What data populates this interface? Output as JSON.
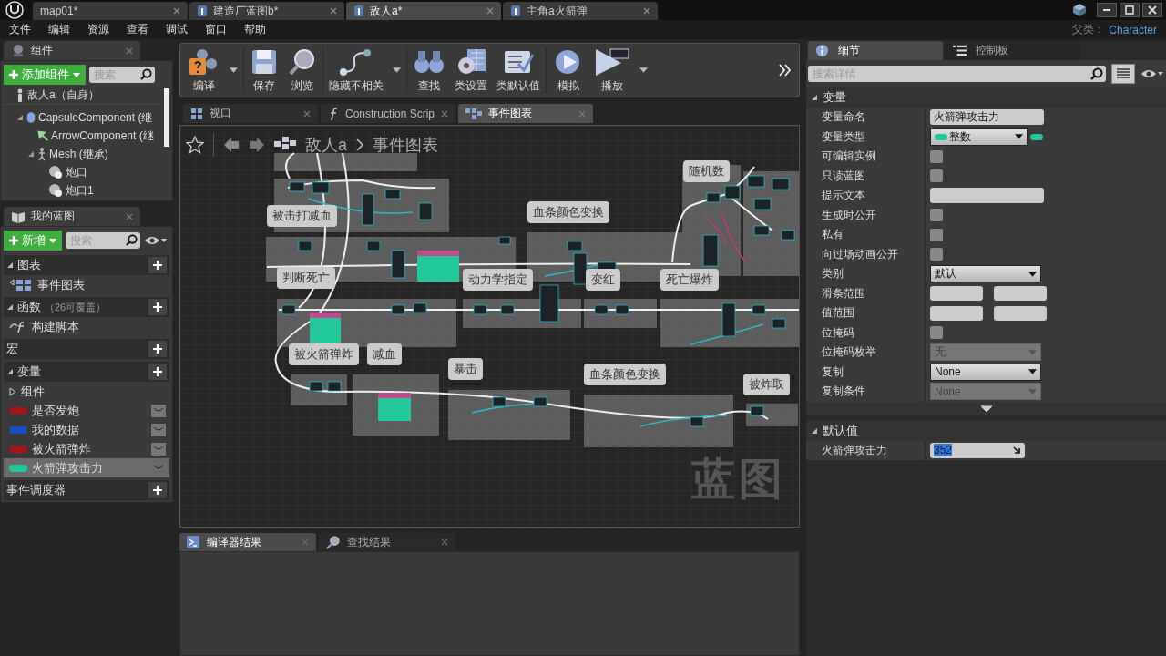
{
  "title_tabs": [
    {
      "label": "map01*",
      "kind": "level",
      "selected": false
    },
    {
      "label": "建造厂蓝图b*",
      "kind": "blueprint",
      "selected": false
    },
    {
      "label": "敌人a*",
      "kind": "blueprint",
      "selected": true
    },
    {
      "label": "主角a火箭弹",
      "kind": "blueprint",
      "selected": false
    }
  ],
  "menu": [
    "文件",
    "编辑",
    "资源",
    "查看",
    "调试",
    "窗口",
    "帮助"
  ],
  "parent_class": {
    "label": "父类：",
    "value": "Character"
  },
  "components_panel": {
    "tab": "组件",
    "add_button": "添加组件",
    "search_placeholder": "搜索",
    "tree": [
      {
        "label": "敌人a（自身）",
        "kind": "self",
        "children": [
          {
            "label": "CapsuleComponent (继",
            "kind": "capsule",
            "expanded": true,
            "children": [
              {
                "label": "ArrowComponent (继",
                "kind": "arrow"
              },
              {
                "label": "Mesh (继承)",
                "kind": "mesh",
                "expanded": true,
                "children": [
                  {
                    "label": "炮口",
                    "kind": "scene"
                  },
                  {
                    "label": "炮口1",
                    "kind": "scene"
                  }
                ]
              }
            ]
          }
        ]
      }
    ]
  },
  "my_blueprint": {
    "tab": "我的蓝图",
    "new_button": "新增",
    "search_placeholder": "搜索",
    "sections": [
      {
        "title": "图表",
        "expanded": true,
        "items": [
          {
            "label": "事件图表",
            "kind": "graph",
            "selected": false
          }
        ]
      },
      {
        "title": "函数",
        "note": "（26可覆盖）",
        "expanded": true,
        "items": [
          {
            "label": "构建脚本",
            "kind": "function",
            "selected": false
          }
        ]
      },
      {
        "title": "宏"
      },
      {
        "title": "变量",
        "expanded": true,
        "items": [
          {
            "label": "组件",
            "kind": "category",
            "selected": false
          },
          {
            "label": "是否发炮",
            "kind": "variable",
            "color": "#a01818",
            "selected": false
          },
          {
            "label": "我的数据",
            "kind": "variable",
            "color": "#1a4fc0",
            "selected": false
          },
          {
            "label": "被火箭弹炸",
            "kind": "variable",
            "color": "#a01818",
            "selected": false
          },
          {
            "label": "火箭弹攻击力",
            "kind": "variable",
            "color": "#1fc79a",
            "selected": true
          }
        ]
      },
      {
        "title": "事件调度器"
      }
    ]
  },
  "toolbar": [
    {
      "label": "编译",
      "kind": "compile",
      "menu": true
    },
    {
      "label": "保存",
      "kind": "save",
      "menu": false
    },
    {
      "label": "浏览",
      "kind": "browse",
      "menu": false
    },
    {
      "label": "隐藏不相关",
      "kind": "hide",
      "menu": true
    },
    {
      "label": "查找",
      "kind": "find",
      "menu": false
    },
    {
      "label": "类设置",
      "kind": "settings",
      "menu": false
    },
    {
      "label": "类默认值",
      "kind": "defaults",
      "menu": false
    },
    {
      "label": "模拟",
      "kind": "simulate",
      "menu": false
    },
    {
      "label": "播放",
      "kind": "play",
      "menu": true
    }
  ],
  "editor_tabs": [
    {
      "label": "视口",
      "kind": "viewport",
      "selected": false
    },
    {
      "label": "Construction Scrip",
      "kind": "function",
      "selected": false
    },
    {
      "label": "事件图表",
      "kind": "graph",
      "selected": true
    }
  ],
  "graph": {
    "breadcrumb": [
      "敌人a",
      "事件图表"
    ],
    "watermark": "蓝图",
    "comments": [
      "被击打减血",
      "血条颜色变换",
      "随机数",
      "判断死亡",
      "动力学指定",
      "变红",
      "死亡爆炸",
      "被火箭弹炸",
      "减血",
      "暴击",
      "血条颜色变换",
      "被炸取"
    ]
  },
  "bottom_tabs": [
    {
      "label": "编译器结果",
      "kind": "log",
      "selected": true
    },
    {
      "label": "查找结果",
      "kind": "search",
      "selected": false
    }
  ],
  "details": {
    "tabs": [
      {
        "label": "细节",
        "selected": true
      },
      {
        "label": "控制板",
        "selected": false
      }
    ],
    "search_placeholder": "搜索详情",
    "sections": [
      {
        "title": "变量",
        "more": true,
        "rows": [
          {
            "label": "变量命名",
            "kind": "text",
            "value": "火箭弹攻击力"
          },
          {
            "label": "变量类型",
            "kind": "type",
            "value": "整数"
          },
          {
            "label": "可编辑实例",
            "kind": "checkbox",
            "checked": false
          },
          {
            "label": "只读蓝图",
            "kind": "checkbox",
            "checked": false
          },
          {
            "label": "提示文本",
            "kind": "text"
          },
          {
            "label": "生成时公开",
            "kind": "checkbox",
            "checked": false
          },
          {
            "label": "私有",
            "kind": "checkbox",
            "checked": false
          },
          {
            "label": "向过场动画公开",
            "kind": "checkbox",
            "checked": false
          },
          {
            "label": "类别",
            "kind": "dropdown",
            "value": "默认",
            "disabled": false
          },
          {
            "label": "滑条范围",
            "kind": "range"
          },
          {
            "label": "值范围",
            "kind": "range"
          },
          {
            "label": "位掩码",
            "kind": "checkbox",
            "checked": false
          },
          {
            "label": "位掩码枚举",
            "kind": "dropdown",
            "value": "无",
            "disabled": true
          },
          {
            "label": "复制",
            "kind": "dropdown",
            "value": "None",
            "disabled": false
          },
          {
            "label": "复制条件",
            "kind": "dropdown",
            "value": "None",
            "disabled": true
          }
        ]
      },
      {
        "title": "默认值",
        "more": false,
        "rows": [
          {
            "label": "火箭弹攻击力",
            "kind": "number",
            "value": "352"
          }
        ]
      }
    ]
  }
}
